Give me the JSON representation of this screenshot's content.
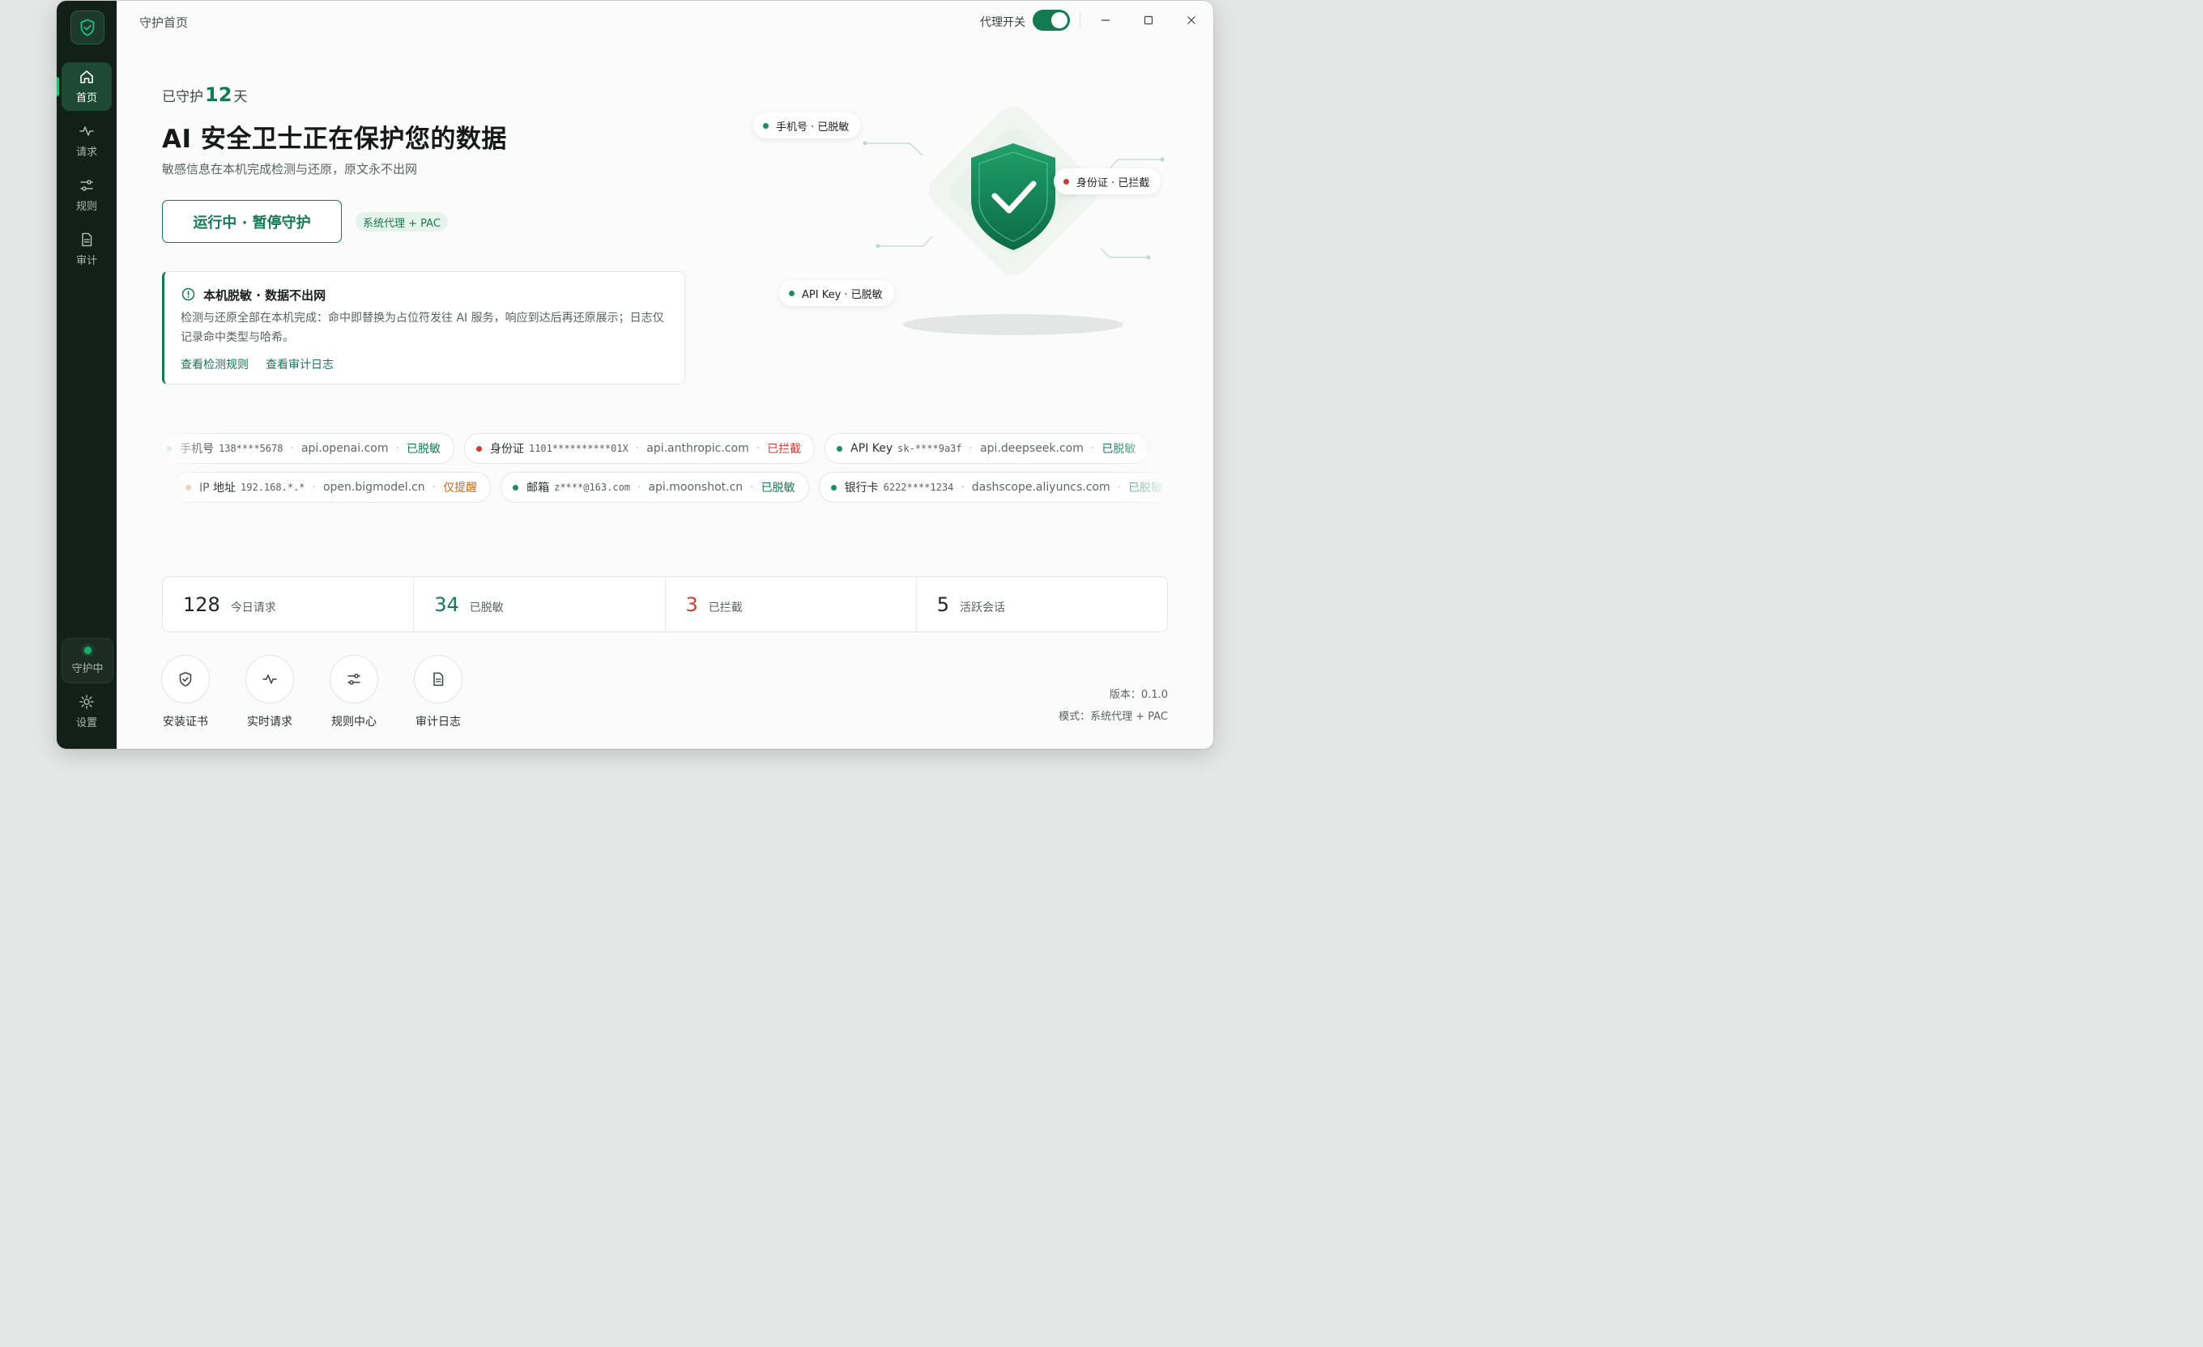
{
  "titlebar": {
    "page_title": "守护首页",
    "proxy_label": "代理开关",
    "proxy_on": true
  },
  "sidebar": {
    "items": [
      {
        "label": "首页",
        "icon": "home-icon",
        "active": true
      },
      {
        "label": "请求",
        "icon": "activity-icon",
        "active": false
      },
      {
        "label": "规则",
        "icon": "sliders-icon",
        "active": false
      },
      {
        "label": "审计",
        "icon": "document-icon",
        "active": false
      }
    ],
    "status_label": "守护中",
    "settings_label": "设置"
  },
  "hero": {
    "days_prefix": "已守护",
    "days_value": "12",
    "days_suffix": "天",
    "headline": "AI 安全卫士正在保护您的数据",
    "subline": "敏感信息在本机完成检测与还原，原文永不出网",
    "run_button": "运行中 · 暂停守护",
    "mode_tag": "系统代理 + PAC"
  },
  "notice": {
    "title": "本机脱敏 · 数据不出网",
    "body": "检测与还原全部在本机完成：命中即替换为占位符发往 AI 服务，响应到达后再还原展示；日志仅记录命中类型与哈希。",
    "link_rules": "查看检测规则",
    "link_audit": "查看审计日志"
  },
  "illustration": {
    "tags": [
      {
        "text": "手机号 · 已脱敏",
        "color": "#1a8f5c"
      },
      {
        "text": "身份证 · 已拦截",
        "color": "#d23a32"
      },
      {
        "text": "API Key · 已脱敏",
        "color": "#1a8f5c"
      }
    ]
  },
  "ticker": {
    "row1": [
      {
        "type": "手机号",
        "value": "138****5678",
        "host": "api.openai.com",
        "action": "已脱敏",
        "dot": "#1a8f5c",
        "action_color": "#137a52"
      },
      {
        "type": "身份证",
        "value": "1101**********01X",
        "host": "api.anthropic.com",
        "action": "已拦截",
        "dot": "#d23a32",
        "action_color": "#d23a32"
      },
      {
        "type": "API Key",
        "value": "sk-****9a3f",
        "host": "api.deepseek.com",
        "action": "已脱敏",
        "dot": "#1a8f5c",
        "action_color": "#137a52"
      }
    ],
    "row2": [
      {
        "type": "IP 地址",
        "value": "192.168.*.*",
        "host": "open.bigmodel.cn",
        "action": "仅提醒",
        "dot": "#e0a56a",
        "action_color": "#cc6a18"
      },
      {
        "type": "邮箱",
        "value": "z****@163.com",
        "host": "api.moonshot.cn",
        "action": "已脱敏",
        "dot": "#1a8f5c",
        "action_color": "#137a52"
      },
      {
        "type": "银行卡",
        "value": "6222****1234",
        "host": "dashscope.aliyuncs.com",
        "action": "已脱敏",
        "dot": "#1a8f5c",
        "action_color": "#137a52"
      }
    ]
  },
  "stats": [
    {
      "value": "128",
      "label": "今日请求",
      "color": "#1a1f1c"
    },
    {
      "value": "34",
      "label": "已脱敏",
      "color": "#137a52"
    },
    {
      "value": "3",
      "label": "已拦截",
      "color": "#d23a32"
    },
    {
      "value": "5",
      "label": "活跃会话",
      "color": "#1a1f1c"
    }
  ],
  "quick_actions": [
    {
      "label": "安装证书",
      "icon": "shield-icon"
    },
    {
      "label": "实时请求",
      "icon": "activity-icon"
    },
    {
      "label": "规则中心",
      "icon": "sliders-icon"
    },
    {
      "label": "审计日志",
      "icon": "document-icon"
    }
  ],
  "footer": {
    "version": "版本：0.1.0",
    "mode": "模式：系统代理 + PAC"
  },
  "colors": {
    "accent": "#137a52",
    "sidebar_bg": "#132019",
    "danger": "#d23a32",
    "warn": "#cc6a18"
  }
}
